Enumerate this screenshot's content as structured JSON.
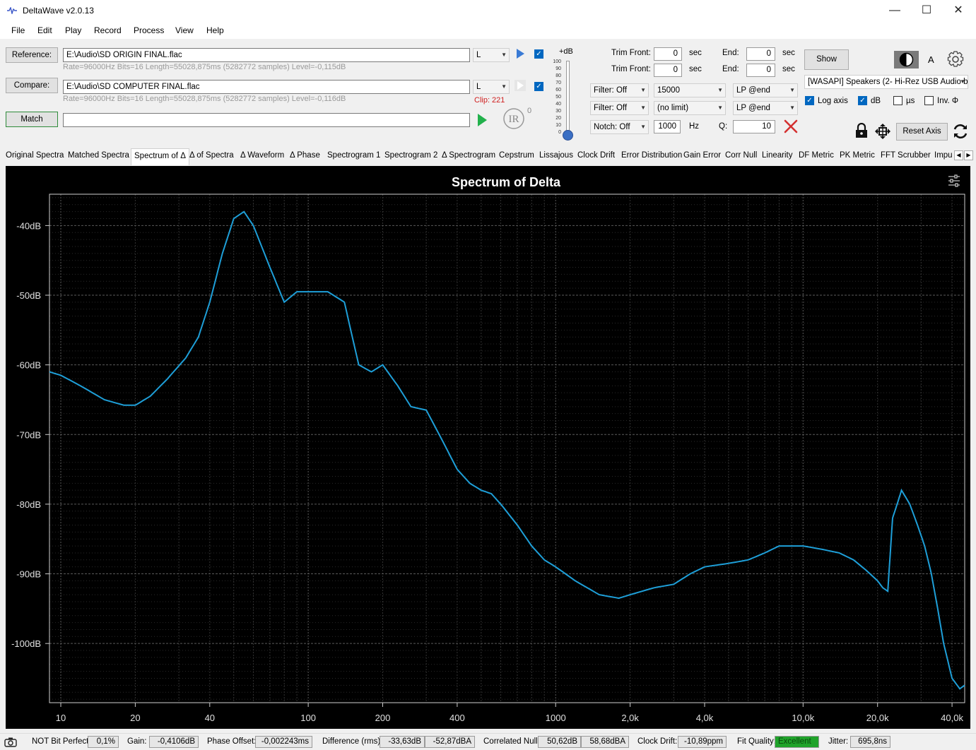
{
  "window": {
    "title": "DeltaWave v2.0.13",
    "min": "—",
    "max": "☐",
    "close": "✕"
  },
  "menu": [
    "File",
    "Edit",
    "Play",
    "Record",
    "Process",
    "View",
    "Help"
  ],
  "reference": {
    "button": "Reference:",
    "path": "E:\\Audio\\SD ORIGIN FINAL.flac",
    "info": "Rate=96000Hz Bits=16 Length=55028,875ms (5282772 samples) Level=-0,115dB",
    "channel": "L"
  },
  "compare": {
    "button": "Compare:",
    "path": "E:\\Audio\\SD COMPUTER FINAL.flac",
    "info": "Rate=96000Hz Bits=16 Length=55028,875ms (5282772 samples) Level=-0,116dB",
    "channel": "L",
    "clip": "Clip: 221"
  },
  "match_button": "Match",
  "ir_label": "IR",
  "ir_sup": "0",
  "gain_slider": {
    "label": "+dB",
    "ticks": [
      "100",
      "90",
      "80",
      "70",
      "60",
      "50",
      "40",
      "30",
      "20",
      "10",
      "0"
    ],
    "value": 0
  },
  "trim": {
    "front_label": "Trim Front:",
    "front1": "0",
    "front2": "0",
    "end_label": "End:",
    "end1": "0",
    "end2": "0",
    "sec": "sec"
  },
  "filters": {
    "filter1": "Filter: Off",
    "freq1": "15000",
    "mode1": "LP @end",
    "filter2": "Filter: Off",
    "freq2": "(no limit)",
    "mode2": "LP @end",
    "notch": "Notch: Off",
    "notch_freq": "1000",
    "hz": "Hz",
    "q_label": "Q:",
    "q": "10"
  },
  "show_button": "Show",
  "font_a": "A",
  "device": "[WASAPI] Speakers (2- Hi-Rez USB Audio b",
  "options": {
    "log_axis": "Log axis",
    "db": "dB",
    "us": "µs",
    "inv": "Inv. Φ"
  },
  "reset_axis": "Reset Axis",
  "tabs": [
    "Original Spectra",
    "Matched Spectra",
    "Spectrum of Δ",
    "Δ of Spectra",
    "Δ Waveform",
    "Δ Phase",
    "Spectrogram 1",
    "Spectrogram 2",
    "Δ Spectrogram",
    "Cepstrum",
    "Lissajous",
    "Clock Drift",
    "Error Distribution",
    "Gain Error",
    "Corr Null",
    "Linearity",
    "DF Metric",
    "PK Metric",
    "FFT Scrubber",
    "Impu"
  ],
  "tab_arrows": {
    "left": "◀",
    "right": "▶"
  },
  "chart_data": {
    "type": "line",
    "title": "Spectrum of Delta",
    "xscale": "log",
    "xlim": [
      9,
      45000
    ],
    "ylim": [
      -108.5,
      -35.5
    ],
    "xticks": [
      10,
      20,
      40,
      100,
      200,
      400,
      1000,
      2000,
      4000,
      10000,
      20000,
      40000
    ],
    "xtick_labels": [
      "10",
      "20",
      "40",
      "100",
      "200",
      "400",
      "1000",
      "2,0k",
      "4,0k",
      "10,0k",
      "20,0k",
      "40,0k"
    ],
    "yticks": [
      -40,
      -50,
      -60,
      -70,
      -80,
      -90,
      -100
    ],
    "ytick_labels": [
      "-40dB",
      "-50dB",
      "-60dB",
      "-70dB",
      "-80dB",
      "-90dB",
      "-100dB"
    ],
    "grid": true,
    "color": "#1e9fd8",
    "series": [
      {
        "x": [
          9,
          10,
          12,
          15,
          18,
          20,
          23,
          27,
          32,
          36,
          40,
          45,
          50,
          55,
          60,
          70,
          80,
          90,
          100,
          120,
          140,
          160,
          180,
          200,
          230,
          260,
          300,
          350,
          400,
          450,
          500,
          550,
          600,
          700,
          800,
          900,
          1000,
          1200,
          1500,
          1800,
          2000,
          2500,
          3000,
          3500,
          4000,
          5000,
          6000,
          7000,
          8000,
          10000,
          12000,
          14000,
          16000,
          18000,
          20000,
          21000,
          22000,
          23000,
          24000,
          25000,
          27000,
          29000,
          31000,
          33000,
          35000,
          37000,
          40000,
          43000,
          45000
        ],
        "y": [
          -61,
          -61.5,
          -63,
          -65,
          -65.8,
          -65.8,
          -64.5,
          -62,
          -59,
          -56,
          -51,
          -44,
          -39,
          -38,
          -40,
          -46,
          -51,
          -49.5,
          -49.5,
          -49.5,
          -51,
          -60,
          -61,
          -60,
          -63,
          -66,
          -66.5,
          -71,
          -75,
          -77,
          -78,
          -78.5,
          -80,
          -83,
          -86,
          -88,
          -89,
          -91,
          -93,
          -93.5,
          -93,
          -92,
          -91.5,
          -90,
          -89,
          -88.5,
          -88,
          -87,
          -86,
          -86,
          -86.5,
          -87,
          -88,
          -89.5,
          -91,
          -92,
          -92.5,
          -82,
          -80,
          -78,
          -80,
          -83,
          -86,
          -90,
          -95,
          -100,
          -105,
          -106.5,
          -106
        ]
      }
    ]
  },
  "status": {
    "bit_perfect_label": "NOT Bit Perfect",
    "bit_perfect_value": "0,1%",
    "gain_label": "Gain:",
    "gain_value": "-0,4106dB",
    "phase_label": "Phase Offset:",
    "phase_value": "-0,002243ms",
    "diff_label": "Difference (rms):",
    "diff_db": "-33,63dB",
    "diff_dba": "-52,87dBA",
    "corr_label": "Correlated Null:",
    "corr_db": "50,62dB",
    "corr_dba": "58,68dBA",
    "drift_label": "Clock Drift:",
    "drift_value": "-10,89ppm",
    "fit_label": "Fit Quality:",
    "fit_value": "Excellent",
    "jitter_label": "Jitter:",
    "jitter_value": "695,8ns"
  }
}
